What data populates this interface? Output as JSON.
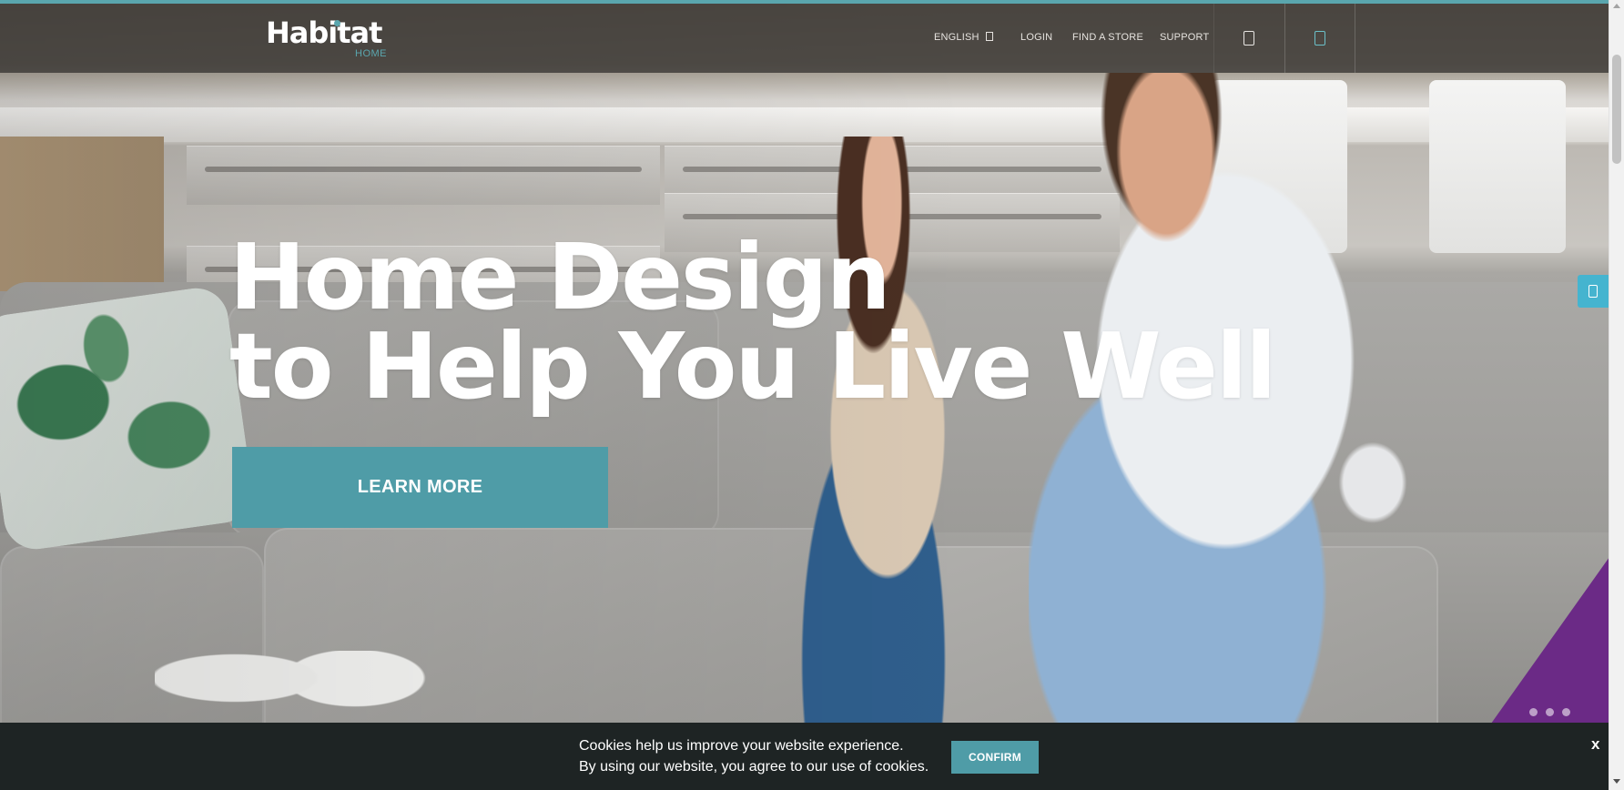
{
  "brand": {
    "name": "Habitat",
    "tagline": "HOME",
    "accent_color": "#5aa6ae",
    "button_color": "#4f9ca7",
    "purple_color": "#6b2a86"
  },
  "header": {
    "nav": {
      "language": "ENGLISH",
      "login": "LOGIN",
      "find_store": "FIND A STORE",
      "support": "SUPPORT"
    },
    "icons": {
      "language_caret": "chevron-down-icon",
      "search": "search-icon",
      "cart": "cart-icon"
    }
  },
  "hero": {
    "headline_line1": "Home Design",
    "headline_line2": "to Help You Live Well",
    "cta_label": "LEARN MORE",
    "slides_count": 3
  },
  "side_tab": {
    "icon": "phone-icon"
  },
  "cookie_banner": {
    "line1": "Cookies help us improve your website experience.",
    "line2": "By using our website, you agree to our use of cookies.",
    "confirm_label": "CONFIRM",
    "close_label": "x"
  }
}
